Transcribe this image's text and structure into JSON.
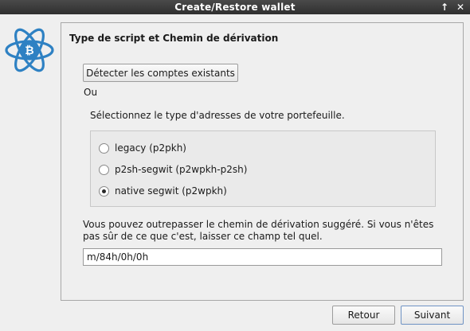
{
  "window": {
    "title": "Create/Restore wallet"
  },
  "titlebar_icons": [
    "pin-icon",
    "close-icon"
  ],
  "logo": {
    "icon": "electrum-bitcoin-logo",
    "color": "#2e81c3"
  },
  "page": {
    "heading": "Type de script et Chemin de dérivation",
    "detect_button": "Détecter les comptes existants",
    "or_label": "Ou",
    "prompt": "Sélectionnez le type d'adresses de votre portefeuille.",
    "options": [
      {
        "label": "legacy (p2pkh)",
        "selected": false
      },
      {
        "label": "p2sh-segwit (p2wpkh-p2sh)",
        "selected": false
      },
      {
        "label": "native segwit (p2wpkh)",
        "selected": true
      }
    ],
    "path_description": "Vous pouvez outrepasser le chemin de dérivation suggéré. Si vous n'êtes pas sûr de ce que c'est, laisser ce champ tel quel.",
    "derivation_path": "m/84h/0h/0h"
  },
  "footer": {
    "back_label": "Retour",
    "next_label": "Suivant"
  }
}
